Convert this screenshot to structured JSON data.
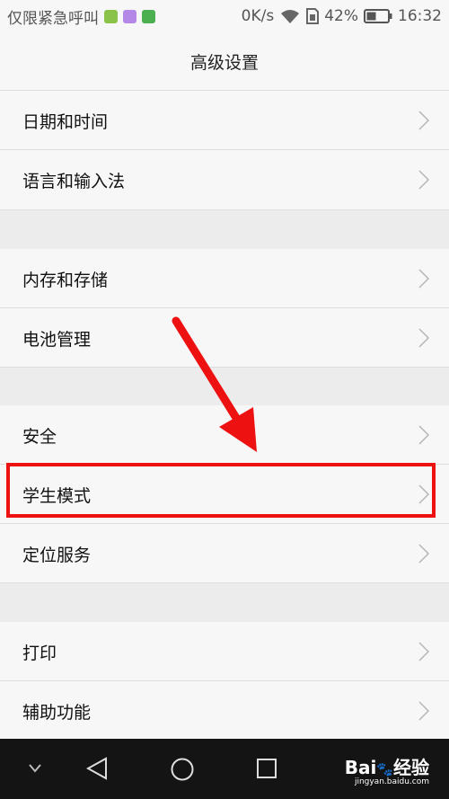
{
  "status_bar": {
    "carrier_text": "仅限紧急呼叫",
    "speed": "0K/s",
    "battery": "42%",
    "time": "16:32"
  },
  "header": {
    "title": "高级设置"
  },
  "settings": {
    "group1": [
      "日期和时间",
      "语言和输入法"
    ],
    "group2": [
      "内存和存储",
      "电池管理"
    ],
    "group3": [
      "安全",
      "学生模式",
      "定位服务"
    ],
    "group4": [
      "打印",
      "辅助功能"
    ]
  },
  "annotation": {
    "highlight_color": "#ee1111"
  },
  "watermark": {
    "brand": "Bai",
    "brand2": "经验",
    "url": "jingyan.baidu.com"
  }
}
